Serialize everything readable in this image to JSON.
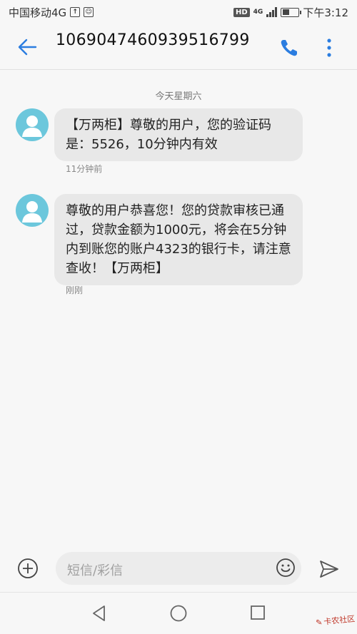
{
  "status_bar": {
    "carrier": "中国移动4G",
    "hd": "HD",
    "network": "4G",
    "time": "下午3:12"
  },
  "header": {
    "contact": "1069047460939516799"
  },
  "conversation": {
    "date_separator": "今天星期六",
    "messages": [
      {
        "text": "【万两柜】尊敬的用户，您的验证码是：5526，10分钟内有效",
        "time": "11分钟前"
      },
      {
        "text": "尊敬的用户恭喜您！您的贷款审核已通过，贷款金额为1000元，将会在5分钟内到账您的账户4323的银行卡，请注意查收！【万两柜】",
        "time": "刚刚"
      }
    ]
  },
  "input_bar": {
    "placeholder": "短信/彩信"
  },
  "watermark": "卡农社区"
}
